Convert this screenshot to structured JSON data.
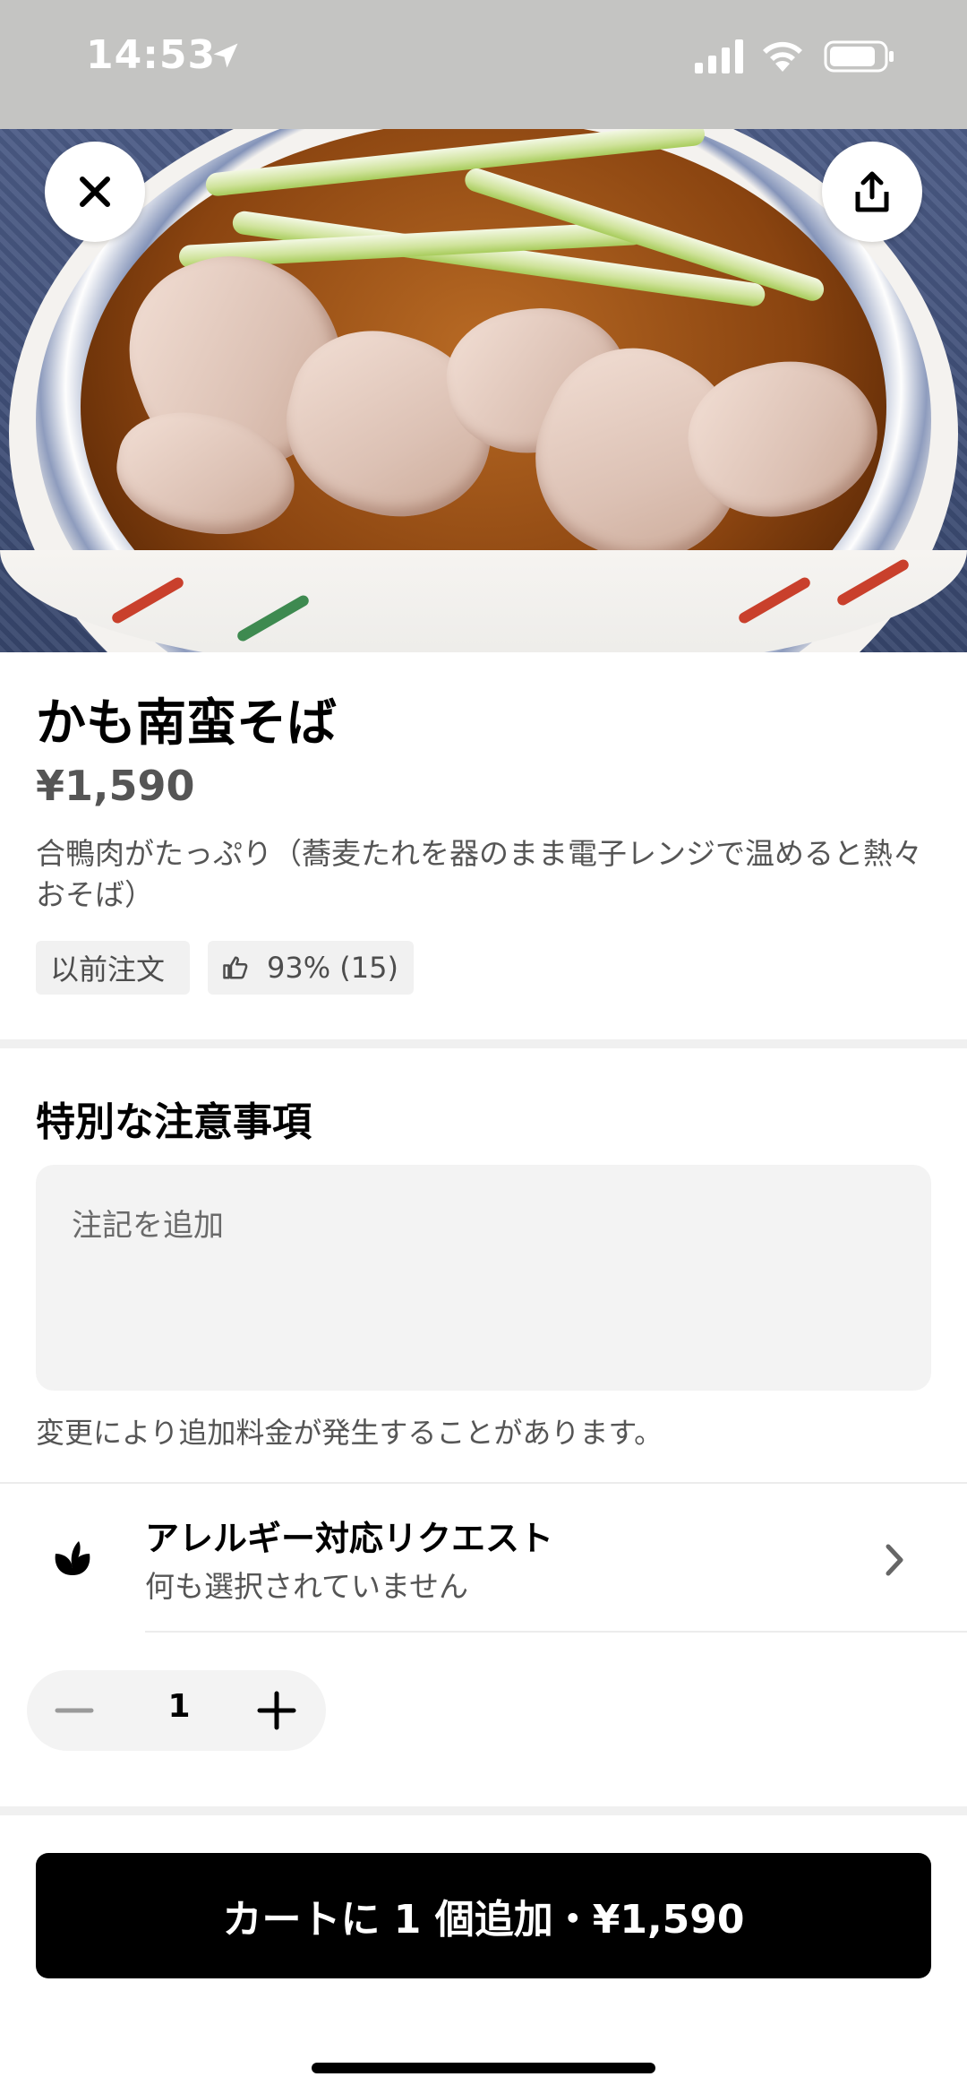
{
  "status_bar": {
    "time": "14:53"
  },
  "item": {
    "title": "かも南蛮そば",
    "price": "¥1,590",
    "description": "合鴨肉がたっぷり（蕎麦たれを器のまま電子レンジで温めると熱々おそば）",
    "tags": {
      "previous_order": "以前注文",
      "rating": "93% (15)"
    }
  },
  "special_instructions": {
    "title": "特別な注意事項",
    "placeholder": "注記を追加",
    "hint": "変更により追加料金が発生することがあります。"
  },
  "allergy": {
    "title": "アレルギー対応リクエスト",
    "subtitle": "何も選択されていません"
  },
  "quantity": {
    "value": "1"
  },
  "cart_button": {
    "label": "カートに 1 個追加・¥1,590"
  },
  "icons": [
    "close-icon",
    "share-icon",
    "location-arrow-icon",
    "signal-icon",
    "wifi-icon",
    "battery-icon",
    "thumbs-up-icon",
    "leaf-icon",
    "chevron-right-icon",
    "minus-icon",
    "plus-icon"
  ]
}
